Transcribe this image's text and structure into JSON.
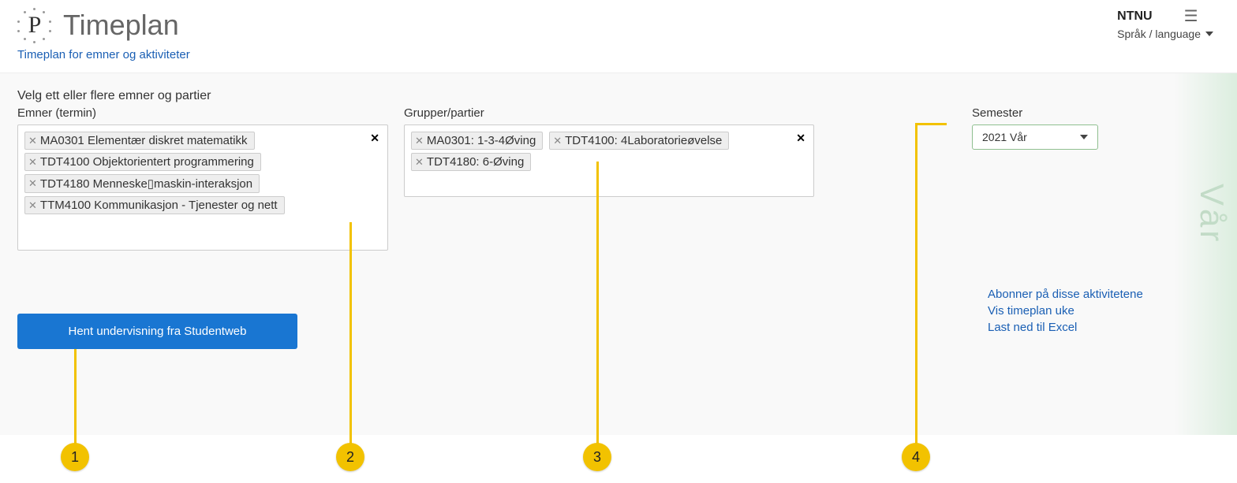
{
  "header": {
    "app_title": "Timeplan",
    "org": "NTNU",
    "language_label": "Språk / language",
    "subheader_link": "Timeplan for emner og aktiviteter"
  },
  "main": {
    "instructions": "Velg ett eller flere emner og partier",
    "courses_label": "Emner (termin)",
    "groups_label": "Grupper/partier",
    "semester_label": "Semester",
    "semester_value": "2021 Vår",
    "side_season": "Vår",
    "courses": [
      "MA0301 Elementær diskret matematikk",
      "TDT4100 Objektorientert programmering",
      "TDT4180 Menneske▯maskin-interaksjon",
      "TTM4100 Kommunikasjon - Tjenester og nett"
    ],
    "groups": [
      "MA0301: 1-3-4Øving",
      "TDT4100: 4Laboratorieøvelse",
      "TDT4180: 6-Øving"
    ],
    "fetch_button": "Hent undervisning fra Studentweb",
    "links": {
      "subscribe": "Abonner på disse aktivitetene",
      "show_week": "Vis timeplan uke",
      "excel": "Last ned til Excel"
    }
  },
  "annotations": [
    "1",
    "2",
    "3",
    "4"
  ]
}
